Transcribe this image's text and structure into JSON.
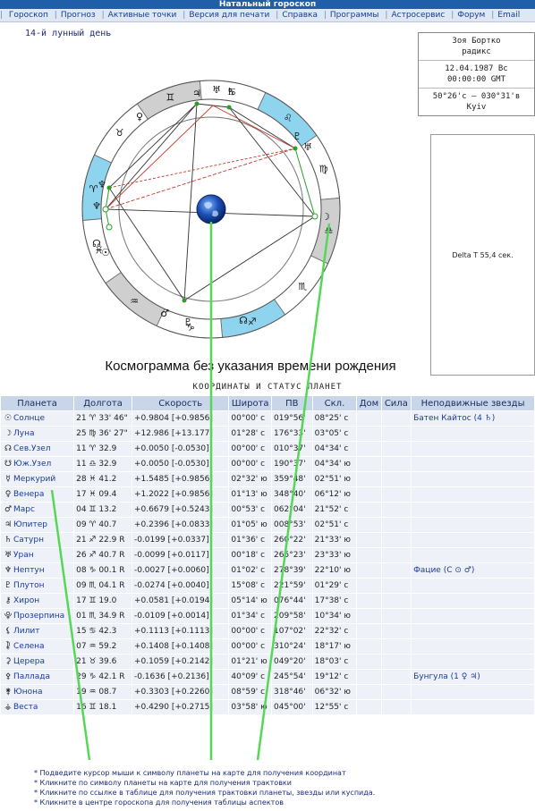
{
  "header": {
    "title": "Натальный гороскоп"
  },
  "menu": [
    "Гороскоп",
    "Прогноз",
    "Активные точки",
    "Версия для печати",
    "Справка",
    "Программы",
    "Астросервис",
    "Форум",
    "Email"
  ],
  "moon_day": "14-й лунный день",
  "info": {
    "name": "Зоя Бортко",
    "type": "радикс",
    "date": "12.04.1987 Вс",
    "time": "00:00:00 GMT",
    "coords": "50°26'с – 030°31'в",
    "place": "Kyiv"
  },
  "delta_t": "Delta T   55,4 сек.",
  "caption": "Космограмма без указания времени рождения",
  "table_title": "КООРДИНАТЫ И СТАТУС ПЛАНЕТ",
  "table": {
    "headers": [
      "Планета",
      "Долгота",
      "Скорость",
      "Широта",
      "ПВ",
      "Скл.",
      "Дом",
      "Сила",
      "Неподвижные звезды"
    ],
    "rows": [
      {
        "glyph": "☉",
        "name": "Солнце",
        "lon": "21 ♈ 33' 46\"",
        "speed": "+0.9804 [+0.9856]",
        "lat": "00°00' с",
        "pv": "019°56'",
        "decl": "08°25' с",
        "dom": "",
        "sila": "",
        "star": "Батен Кайтос (4 ♄)"
      },
      {
        "glyph": "☽",
        "name": "Луна",
        "lon": "25 ♍ 36' 27\"",
        "speed": "+12.986 [+13.177]",
        "lat": "01°28' с",
        "pv": "176°33'",
        "decl": "03°05' с",
        "dom": "",
        "sila": "",
        "star": ""
      },
      {
        "glyph": "☊",
        "name": "Сев.Узел",
        "lon": "11 ♈ 32.9",
        "speed": "+0.0050 [-0.0530]",
        "lat": "00°00' с",
        "pv": "010°37'",
        "decl": "04°34' с",
        "dom": "",
        "sila": "",
        "star": ""
      },
      {
        "glyph": "☋",
        "name": "Юж.Узел",
        "lon": "11 ♎ 32.9",
        "speed": "+0.0050 [-0.0530]",
        "lat": "00°00' с",
        "pv": "190°37'",
        "decl": "04°34' ю",
        "dom": "",
        "sila": "",
        "star": ""
      },
      {
        "glyph": "☿",
        "name": "Меркурий",
        "lon": "28 ♓ 41.2",
        "speed": "+1.5485 [+0.9856]",
        "lat": "02°32' ю",
        "pv": "359°48'",
        "decl": "02°51' ю",
        "dom": "",
        "sila": "",
        "star": ""
      },
      {
        "glyph": "♀",
        "name": "Венера",
        "lon": "17 ♓ 09.4",
        "speed": "+1.2022 [+0.9856]",
        "lat": "01°13' ю",
        "pv": "348°40'",
        "decl": "06°12' ю",
        "dom": "",
        "sila": "",
        "star": ""
      },
      {
        "glyph": "♂",
        "name": "Марс",
        "lon": "04 ♊ 13.2",
        "speed": "+0.6679 [+0.5243]",
        "lat": "00°53' с",
        "pv": "062°04'",
        "decl": "21°52' с",
        "dom": "",
        "sila": "",
        "star": ""
      },
      {
        "glyph": "♃",
        "name": "Юпитер",
        "lon": "09 ♈ 40.7",
        "speed": "+0.2396 [+0.0833]",
        "lat": "01°05' ю",
        "pv": "008°53'",
        "decl": "02°51' с",
        "dom": "",
        "sila": "",
        "star": ""
      },
      {
        "glyph": "♄",
        "name": "Сатурн",
        "lon": "21 ♐ 22.9 R",
        "speed": "-0.0199 [+0.0337]",
        "lat": "01°36' с",
        "pv": "260°22'",
        "decl": "21°33' ю",
        "dom": "",
        "sila": "",
        "star": ""
      },
      {
        "glyph": "♅",
        "name": "Уран",
        "lon": "26 ♐ 40.7 R",
        "speed": "-0.0099 [+0.0117]",
        "lat": "00°18' с",
        "pv": "265°23'",
        "decl": "23°33' ю",
        "dom": "",
        "sila": "",
        "star": ""
      },
      {
        "glyph": "♆",
        "name": "Нептун",
        "lon": "08 ♑ 00.1 R",
        "speed": "-0.0027 [+0.0060]",
        "lat": "01°02' с",
        "pv": "278°39'",
        "decl": "22°10' ю",
        "dom": "",
        "sila": "",
        "star": "Фацие (С ⊙ ♂)"
      },
      {
        "glyph": "♇",
        "name": "Плутон",
        "lon": "09 ♏ 04.1 R",
        "speed": "-0.0274 [+0.0040]",
        "lat": "15°08' с",
        "pv": "221°59'",
        "decl": "01°29' с",
        "dom": "",
        "sila": "",
        "star": ""
      },
      {
        "glyph": "⚷",
        "name": "Хирон",
        "lon": "17 ♊ 19.0",
        "speed": "+0.0581 [+0.0194]",
        "lat": "05°14' ю",
        "pv": "076°44'",
        "decl": "17°38' с",
        "dom": "",
        "sila": "",
        "star": ""
      },
      {
        "glyph": "⯓",
        "name": "Прозерпина",
        "lon": "01 ♏ 34.9 R",
        "speed": "-0.0109 [+0.0014]",
        "lat": "01°34' с",
        "pv": "209°58'",
        "decl": "10°34' ю",
        "dom": "",
        "sila": "",
        "star": ""
      },
      {
        "glyph": "⚸",
        "name": "Лилит",
        "lon": "15 ♋ 42.3",
        "speed": "+0.1113 [+0.1113]",
        "lat": "00°00' с",
        "pv": "107°02'",
        "decl": "22°32' с",
        "dom": "",
        "sila": "",
        "star": ""
      },
      {
        "glyph": "⯝",
        "name": "Селена",
        "lon": "07 ♒ 59.2",
        "speed": "+0.1408 [+0.1408]",
        "lat": "00°00' с",
        "pv": "310°24'",
        "decl": "18°17' ю",
        "dom": "",
        "sila": "",
        "star": ""
      },
      {
        "glyph": "⚳",
        "name": "Церера",
        "lon": "21 ♉ 39.6",
        "speed": "+0.1059 [+0.2142]",
        "lat": "01°21' ю",
        "pv": "049°20'",
        "decl": "18°03' с",
        "dom": "",
        "sila": "",
        "star": ""
      },
      {
        "glyph": "⚴",
        "name": "Паллада",
        "lon": "29 ♑ 42.1 R",
        "speed": "-0.1636 [+0.2136]",
        "lat": "40°09' с",
        "pv": "245°54'",
        "decl": "19°12' с",
        "dom": "",
        "sila": "",
        "star": "Бунгула (1 ♀ ♃)"
      },
      {
        "glyph": "⚵",
        "name": "Юнона",
        "lon": "19 ♒ 08.7",
        "speed": "+0.3303 [+0.2260]",
        "lat": "08°59' с",
        "pv": "318°46'",
        "decl": "06°32' ю",
        "dom": "",
        "sila": "",
        "star": ""
      },
      {
        "glyph": "⚶",
        "name": "Веста",
        "lon": "16 ♊ 18.1",
        "speed": "+0.4290 [+0.2715]",
        "lat": "03°58' ю",
        "pv": "045°00'",
        "decl": "12°55' с",
        "dom": "",
        "sila": "",
        "star": ""
      }
    ]
  },
  "notes": [
    "* Подведите курсор мыши к символу планеты на карте для получения координат",
    "* Кликните по символу планеты на карте для получения трактовки",
    "* Кликните по ссылке в таблице для получения трактовки планеты, звезды или куспида.",
    "* Кликните в центре гороскопа для получения таблицы аспектов"
  ],
  "colors": {
    "title_bg": "#1f5ea8",
    "menu_bg": "#dfe7f3",
    "ring_blue": "#8ed4ee",
    "ring_gray": "#cfcfcf",
    "aspect_green": "#5ad85a",
    "aspect_red": "#c0392b",
    "table_header": "#c9d6ea",
    "table_cell": "#eef2f8"
  }
}
